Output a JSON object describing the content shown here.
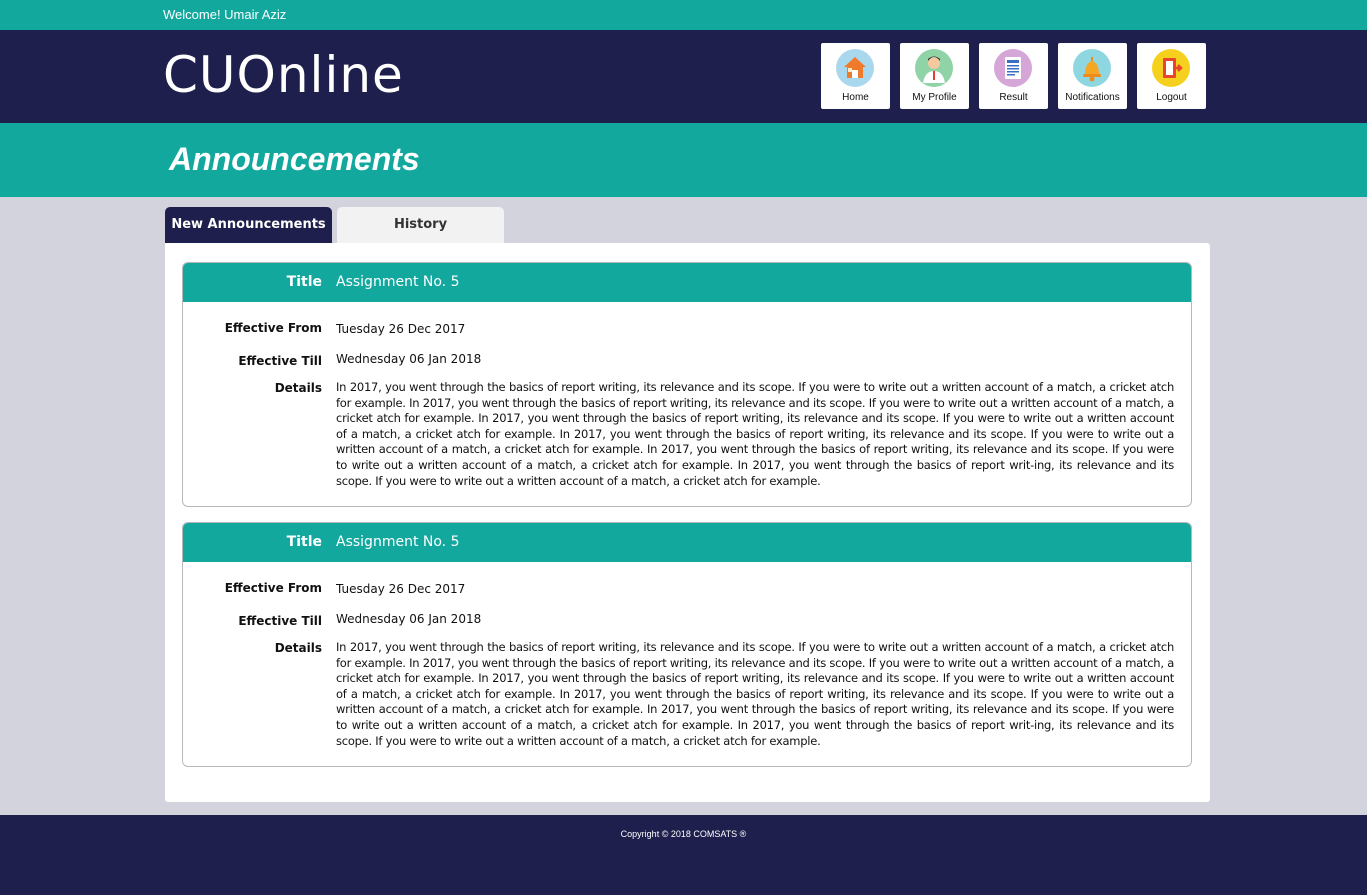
{
  "topbar": {
    "welcome": "Welcome! Umair Aziz"
  },
  "header": {
    "logo_text": "CUOnline",
    "nav": [
      {
        "label": "Home",
        "icon": "home-icon",
        "color": "#a9d8ee"
      },
      {
        "label": "My Profile",
        "icon": "profile-icon",
        "color": "#8fd3a6"
      },
      {
        "label": "Result",
        "icon": "result-icon",
        "color": "#d6a6d8"
      },
      {
        "label": "Notifications",
        "icon": "bell-icon",
        "color": "#8fd7e0"
      },
      {
        "label": "Logout",
        "icon": "logout-icon",
        "color": "#f5d11d"
      }
    ]
  },
  "page": {
    "title": "Announcements"
  },
  "tabs": {
    "new_label": "New Announcements",
    "history_label": "History"
  },
  "announcements": [
    {
      "title_label": "Title",
      "title": "Assignment No. 5",
      "from_label": "Effective From",
      "from": "Tuesday 26 Dec 2017",
      "till_label": "Effective Till",
      "till": "Wednesday 06 Jan 2018",
      "details_label": "Details",
      "details": "In 2017,  you went through the basics of report writing, its relevance and its scope. If you were to write out a written account of a match, a cricket atch for example. In 2017,  you went through the basics of report writing, its relevance and its scope. If you were to write out a written account of a match, a cricket atch for example. In 2017,  you went through the basics of report writing, its relevance and its scope. If you were to write out a written account of a match, a cricket atch for example. In 2017,  you went through the basics of report writing, its relevance and its scope. If you were to write out a written account of a match, a cricket atch for example. In 2017,  you went through the basics of report writing, its relevance and its scope. If you were to write out a written account of a match, a cricket atch for example. In 2017,  you went through the basics of report writ-ing, its relevance and its scope. If you were to write out a written account of a match, a cricket atch for example."
    },
    {
      "title_label": "Title",
      "title": "Assignment No. 5",
      "from_label": "Effective From",
      "from": "Tuesday 26 Dec 2017",
      "till_label": "Effective Till",
      "till": "Wednesday 06 Jan 2018",
      "details_label": "Details",
      "details": "In 2017,  you went through the basics of report writing, its relevance and its scope. If you were to write out a written account of a match, a cricket atch for example. In 2017,  you went through the basics of report writing, its relevance and its scope. If you were to write out a written account of a match, a cricket atch for example. In 2017,  you went through the basics of report writing, its relevance and its scope. If you were to write out a written account of a match, a cricket atch for example. In 2017,  you went through the basics of report writing, its relevance and its scope. If you were to write out a written account of a match, a cricket atch for example. In 2017,  you went through the basics of report writing, its relevance and its scope. If you were to write out a written account of a match, a cricket atch for example. In 2017,  you went through the basics of report writ-ing, its relevance and its scope. If you were to write out a written account of a match, a cricket atch for example."
    }
  ],
  "footer": {
    "copyright": "Copyright © 2018 COMSATS ®"
  },
  "colors": {
    "teal": "#12a89e",
    "navy": "#1f1f4d",
    "background": "#d2d3dc"
  }
}
